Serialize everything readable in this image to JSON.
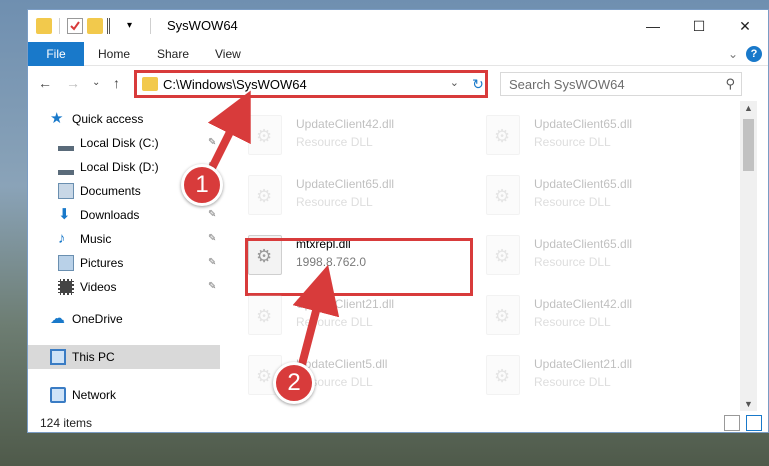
{
  "window": {
    "title": "SysWOW64",
    "min_glyph": "—",
    "max_glyph": "☐",
    "close_glyph": "✕"
  },
  "ribbon": {
    "tabs": [
      "File",
      "Home",
      "Share",
      "View"
    ],
    "expand_glyph": "⌄",
    "help_glyph": "?"
  },
  "nav": {
    "back_glyph": "←",
    "forward_glyph": "→",
    "recent_glyph": "⌄",
    "up_glyph": "↑",
    "address": "C:\\Windows\\SysWOW64",
    "address_dropdown_glyph": "⌄",
    "refresh_glyph": "↻",
    "search_placeholder": "Search SysWOW64",
    "search_glyph": "⚲"
  },
  "sidebar": {
    "pin_glyph": "✎",
    "items": [
      {
        "label": "Quick access",
        "icon": "star-icon",
        "color": "#1979ca"
      },
      {
        "label": "Local Disk (C:)",
        "icon": "drive-icon",
        "color": "#5a6b7a"
      },
      {
        "label": "Local Disk (D:)",
        "icon": "drive-icon",
        "color": "#5a6b7a"
      },
      {
        "label": "Documents",
        "icon": "documents-icon",
        "color": "#6a8fb0"
      },
      {
        "label": "Downloads",
        "icon": "download-icon",
        "color": "#1979ca"
      },
      {
        "label": "Music",
        "icon": "music-icon",
        "color": "#1979ca"
      },
      {
        "label": "Pictures",
        "icon": "pictures-icon",
        "color": "#6a8fb0"
      },
      {
        "label": "Videos",
        "icon": "videos-icon",
        "color": "#444"
      },
      {
        "label": "OneDrive",
        "icon": "cloud-icon",
        "color": "#1979ca"
      },
      {
        "label": "This PC",
        "icon": "computer-icon",
        "color": "#3a7cc4"
      },
      {
        "label": "Network",
        "icon": "network-icon",
        "color": "#3a7cc4"
      }
    ]
  },
  "files": [
    {
      "name": "UpdateClient42.dll",
      "type": "Resource DLL"
    },
    {
      "name": "UpdateClient65.dll",
      "type": "Resource DLL"
    },
    {
      "name": "UpdateClient65.dll",
      "type": "Resource DLL"
    },
    {
      "name": "UpdateClient65.dll",
      "type": "Resource DLL"
    },
    {
      "name": "mtxrepl.dll",
      "type": "1998.8.762.0"
    },
    {
      "name": "UpdateClient65.dll",
      "type": "Resource DLL"
    },
    {
      "name": "UpdateClient21.dll",
      "type": "Resource DLL"
    },
    {
      "name": "UpdateClient42.dll",
      "type": "Resource DLL"
    },
    {
      "name": "UpdateClient5.dll",
      "type": "Resource DLL"
    },
    {
      "name": "UpdateClient21.dll",
      "type": "Resource DLL"
    }
  ],
  "status": {
    "item_count": "124 items"
  },
  "annotations": {
    "step1": "1",
    "step2": "2",
    "accent_red": "#d83b3b"
  }
}
